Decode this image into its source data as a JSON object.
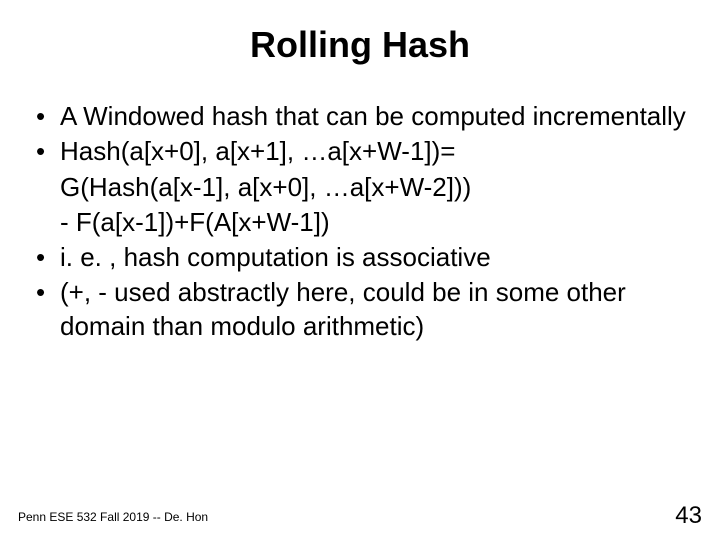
{
  "title": "Rolling Hash",
  "bullets": [
    {
      "text": "A Windowed hash that can be computed incrementally",
      "cont": []
    },
    {
      "text": "Hash(a[x+0], a[x+1], …a[x+W-1])=",
      "cont": [
        "G(Hash(a[x-1], a[x+0], …a[x+W-2]))",
        "- F(a[x-1])+F(A[x+W-1])"
      ]
    },
    {
      "text": "i. e. , hash computation is associative",
      "cont": []
    },
    {
      "text": "(+, - used abstractly here, could be in some other domain than modulo arithmetic)",
      "cont": []
    }
  ],
  "footer": "Penn ESE 532 Fall 2019 -- De. Hon",
  "page_number": "43"
}
